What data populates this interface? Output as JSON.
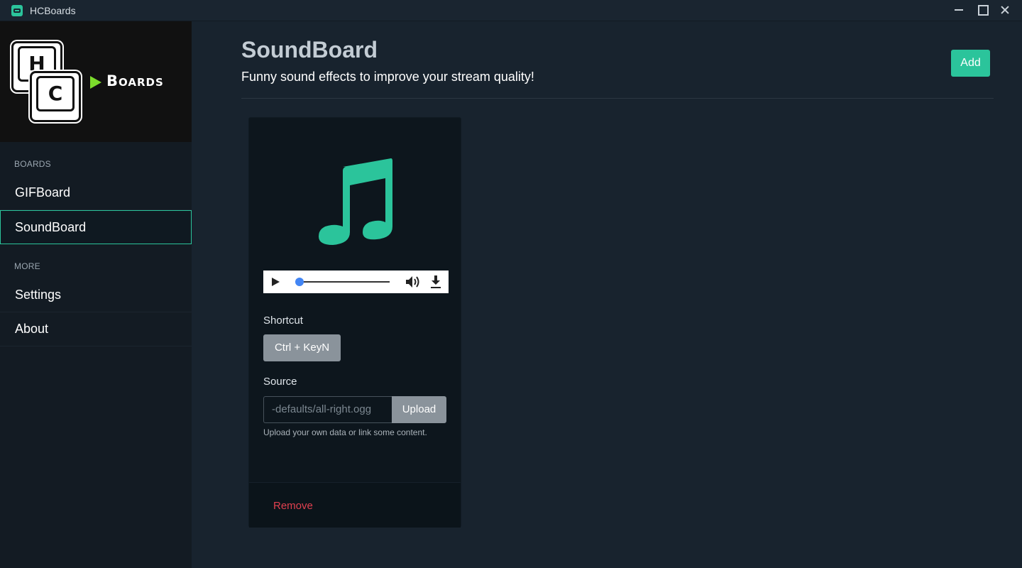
{
  "window": {
    "title": "HCBoards",
    "controls": [
      "minimize-icon",
      "maximize-icon",
      "close-icon"
    ]
  },
  "logo": {
    "key1": "H",
    "key2": "C",
    "text": "Boards"
  },
  "sidebar": {
    "sections": [
      {
        "label": "BOARDS",
        "items": [
          {
            "label": "GIFBoard",
            "active": false
          },
          {
            "label": "SoundBoard",
            "active": true
          }
        ]
      },
      {
        "label": "MORE",
        "items": [
          {
            "label": "Settings",
            "active": false
          },
          {
            "label": "About",
            "active": false
          }
        ]
      }
    ]
  },
  "header": {
    "title": "SoundBoard",
    "subtitle": "Funny sound effects to improve your stream quality!",
    "add_label": "Add"
  },
  "card": {
    "icon": "music-note-icon",
    "player": {
      "progress": 0,
      "icons": [
        "play-icon",
        "volume-icon",
        "download-icon"
      ]
    },
    "shortcut_label": "Shortcut",
    "shortcut_value": "Ctrl + KeyN",
    "source_label": "Source",
    "source_value": "-defaults/all-right.ogg",
    "upload_label": "Upload",
    "help_text": "Upload your own data or link some content.",
    "remove_label": "Remove"
  },
  "colors": {
    "accent": "#2bc49b",
    "danger": "#e0404f",
    "logo_arrow": "#7cdc2c",
    "background": "#18232e",
    "sidebar": "#131b23"
  }
}
